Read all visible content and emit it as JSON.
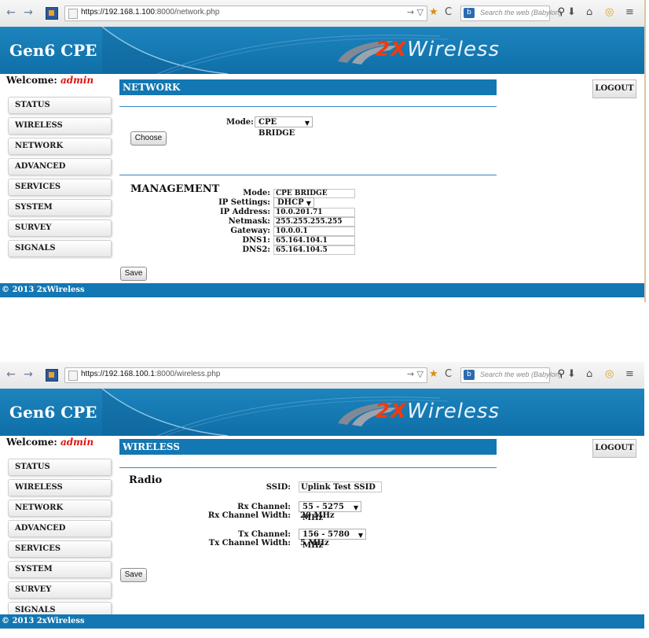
{
  "browser": {
    "back": "←",
    "forward": "→",
    "go": "→ ▽",
    "reload": "C",
    "home": "⌂",
    "download": "⬇",
    "search_placeholder": "Search the web (Babylon)"
  },
  "network_page": {
    "url_host": "https://192.168.1.100",
    "url_path": ":8000/network.php",
    "app_title": "Gen6 CPE",
    "brand_prefix": "2X",
    "brand_suffix": "Wireless",
    "welcome_label": "Welcome:",
    "welcome_user": "admin",
    "logout": "LOGOUT",
    "menu": [
      "STATUS",
      "WIRELESS",
      "NETWORK",
      "ADVANCED",
      "SERVICES",
      "SYSTEM",
      "SURVEY",
      "SIGNALS"
    ],
    "header": "NETWORK",
    "mode_label": "Mode:",
    "mode_value": "CPE BRIDGE",
    "choose": "Choose",
    "management_title": "MANAGEMENT",
    "mgmt_fields": [
      {
        "label": "Mode:",
        "value": "CPE BRIDGE"
      },
      {
        "label": "IP Settings:",
        "value": "DHCP"
      },
      {
        "label": "IP Address:",
        "value": "10.0.201.71"
      },
      {
        "label": "Netmask:",
        "value": "255.255.255.255"
      },
      {
        "label": "Gateway:",
        "value": "10.0.0.1"
      },
      {
        "label": "DNS1:",
        "value": "65.164.104.1"
      },
      {
        "label": "DNS2:",
        "value": "65.164.104.5"
      }
    ],
    "save": "Save",
    "footer": "© 2013 2xWireless"
  },
  "wireless_page": {
    "url_host": "https://192.168.100.1",
    "url_path": ":8000/wireless.php",
    "app_title": "Gen6 CPE",
    "brand_prefix": "2X",
    "brand_suffix": "Wireless",
    "welcome_label": "Welcome:",
    "welcome_user": "admin",
    "logout": "LOGOUT",
    "menu": [
      "STATUS",
      "WIRELESS",
      "NETWORK",
      "ADVANCED",
      "SERVICES",
      "SYSTEM",
      "SURVEY",
      "SIGNALS"
    ],
    "header": "WIRELESS",
    "radio_title": "Radio",
    "ssid_label": "SSID:",
    "ssid_value": "Uplink Test SSID",
    "rx_channel_label": "Rx Channel:",
    "rx_channel_value": "55 - 5275 MHz",
    "rx_width_label": "Rx Channel Width:",
    "rx_width_value": "20 MHz",
    "tx_channel_label": "Tx Channel:",
    "tx_channel_value": "156 - 5780 MHz",
    "tx_width_label": "Tx Channel Width:",
    "tx_width_value": "5 MHz",
    "save": "Save",
    "footer": "© 2013 2xWireless"
  }
}
